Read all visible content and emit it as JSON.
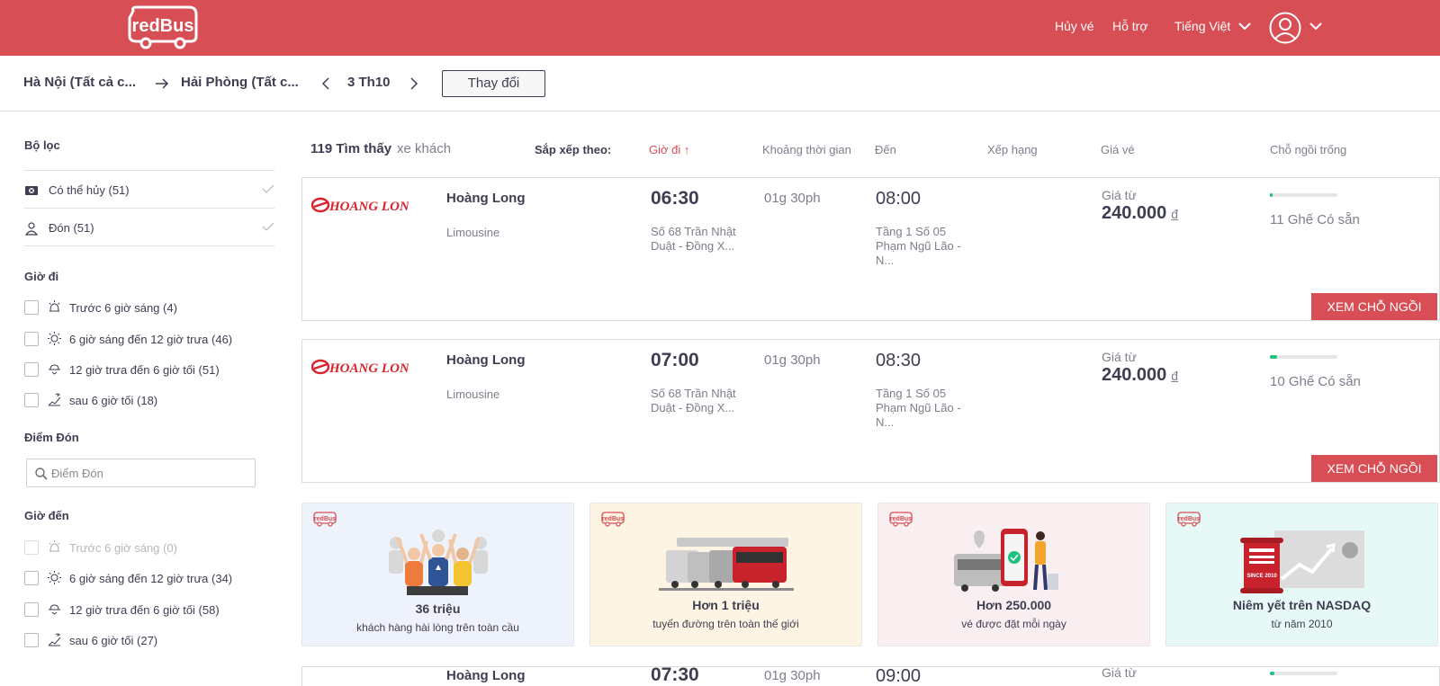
{
  "header": {
    "logo_text": "redBus",
    "nav": {
      "cancel": "Hủy vé",
      "help": "Hỗ trợ",
      "language": "Tiếng Việt"
    },
    "brand_color": "#d84e55"
  },
  "search": {
    "from": "Hà Nội (Tất cả c...",
    "to": "Hải Phòng (Tất c...",
    "date": "3 Th10",
    "change_label": "Thay đổi"
  },
  "filters": {
    "title": "Bộ lọc",
    "quick": [
      {
        "label": "Có thể hủy (51)",
        "icon": "cancel-ticket-icon"
      },
      {
        "label": "Đón (51)",
        "icon": "pickup-person-icon"
      }
    ],
    "departure": {
      "title": "Giờ đi",
      "options": [
        {
          "label": "Trước 6 giờ sáng (4)",
          "icon": "sunrise-icon",
          "disabled": false
        },
        {
          "label": "6 giờ sáng đến 12 giờ trưa (46)",
          "icon": "sun-icon",
          "disabled": false
        },
        {
          "label": "12 giờ trưa đến 6 giờ tối (51)",
          "icon": "sunset-icon",
          "disabled": false
        },
        {
          "label": "sau 6 giờ tối (18)",
          "icon": "night-icon",
          "disabled": false
        }
      ]
    },
    "pickup": {
      "title": "Điểm Đón",
      "placeholder": "Điểm Đón"
    },
    "arrival": {
      "title": "Giờ đến",
      "options": [
        {
          "label": "Trước 6 giờ sáng (0)",
          "icon": "sunrise-icon",
          "disabled": true
        },
        {
          "label": "6 giờ sáng đến 12 giờ trưa (34)",
          "icon": "sun-icon",
          "disabled": false
        },
        {
          "label": "12 giờ trưa đến 6 giờ tối (58)",
          "icon": "sunset-icon",
          "disabled": false
        },
        {
          "label": "sau 6 giờ tối (27)",
          "icon": "night-icon",
          "disabled": false
        }
      ]
    }
  },
  "results": {
    "count": "119 Tìm thấy",
    "count_suffix": "xe khách",
    "sort_by": "Sắp xếp theo:",
    "sort_options": {
      "departure": "Giờ đi ↑",
      "duration": "Khoảng thời gian",
      "arrival": "Đến",
      "rating": "Xếp hạng",
      "fare": "Giá vé",
      "seats": "Chỗ ngồi trống"
    }
  },
  "buses": [
    {
      "operator_logo_text": "HOANG LONG",
      "operator": "Hoàng Long",
      "type": "Limousine",
      "departure_time": "06:30",
      "departure_place": "Số 68 Trần Nhật Duật - Đồng X...",
      "duration": "01g 30ph",
      "arrival_time": "08:00",
      "arrival_place": "Tầng 1 Số 05 Phạm Ngũ Lão - N...",
      "fare_label": "Giá từ",
      "fare": "240.000",
      "currency": "đ",
      "seats": "11 Ghế Có sẵn",
      "seat_fill": 0.04,
      "view_label": "XEM CHỖ NGỒI"
    },
    {
      "operator_logo_text": "HOANG LONG",
      "operator": "Hoàng Long",
      "type": "Limousine",
      "departure_time": "07:00",
      "departure_place": "Số 68 Trần Nhật Duật - Đồng X...",
      "duration": "01g 30ph",
      "arrival_time": "08:30",
      "arrival_place": "Tầng 1 Số 05 Phạm Ngũ Lão - N...",
      "fare_label": "Giá từ",
      "fare": "240.000",
      "currency": "đ",
      "seats": "10 Ghế Có sẵn",
      "seat_fill": 0.1,
      "view_label": "XEM CHỖ NGỒI"
    }
  ],
  "promos": [
    {
      "title": "36 triệu",
      "subtitle": "khách hàng hài lòng trên toàn cầu",
      "bg": "#eef3fb",
      "mini_logo": "redBus"
    },
    {
      "title": "Hơn 1 triệu",
      "subtitle": "tuyến đường trên toàn thế giới",
      "bg": "#fdf4e3",
      "mini_logo": "redBus"
    },
    {
      "title": "Hơn 250.000",
      "subtitle": "vé được đặt mỗi ngày",
      "bg": "#f9eef0",
      "mini_logo": "redBus"
    },
    {
      "title": "Niêm yết trên NASDAQ",
      "subtitle": "từ năm 2010",
      "bg": "#e7f9f6",
      "mini_logo": "redBus",
      "badge": "SINCE 2010"
    }
  ],
  "partial_bus": {
    "operator": "Hoàng Long",
    "departure_time": "07:30",
    "duration": "01g 30ph",
    "arrival_time": "09:00",
    "fare_label": "Giá từ"
  }
}
